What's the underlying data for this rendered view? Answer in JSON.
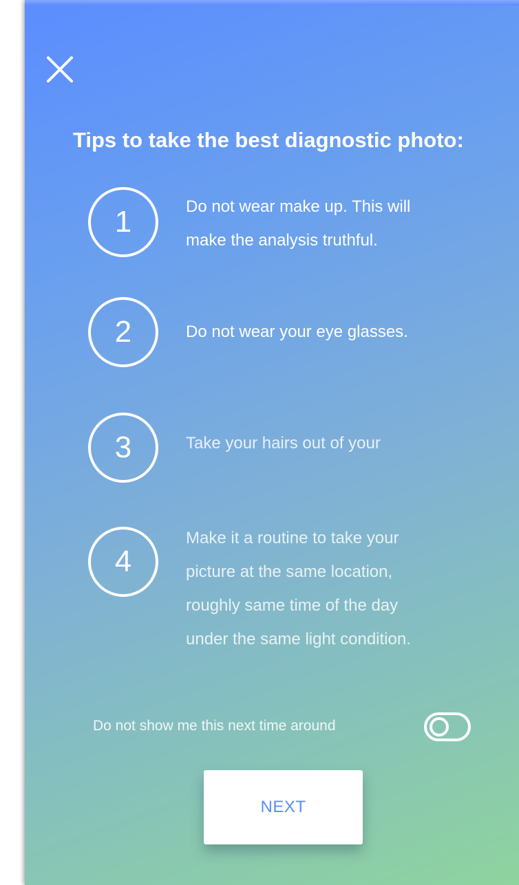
{
  "header": {
    "close_icon": "close-icon"
  },
  "title": "Tips to take the best diagnostic photo:",
  "tips": [
    {
      "number": "1",
      "lines": [
        "Do not wear make up. This will",
        "make the analysis truthful."
      ]
    },
    {
      "number": "2",
      "lines": [
        "Do not wear your eye glasses."
      ]
    },
    {
      "number": "3",
      "lines": [
        "Take your hairs out of your"
      ]
    },
    {
      "number": "4",
      "lines": [
        "Make it a routine to take your",
        "picture at the same location,",
        "roughly same time of the day",
        "under the same light condition."
      ]
    }
  ],
  "toggle": {
    "label": "Do not show me this next time around",
    "state": "off"
  },
  "next_button": {
    "label": "NEXT"
  },
  "colors": {
    "gradient_top": "#5b8dff",
    "gradient_bottom": "#8fd39f",
    "accent": "#5b8dff",
    "text": "#ffffff"
  }
}
